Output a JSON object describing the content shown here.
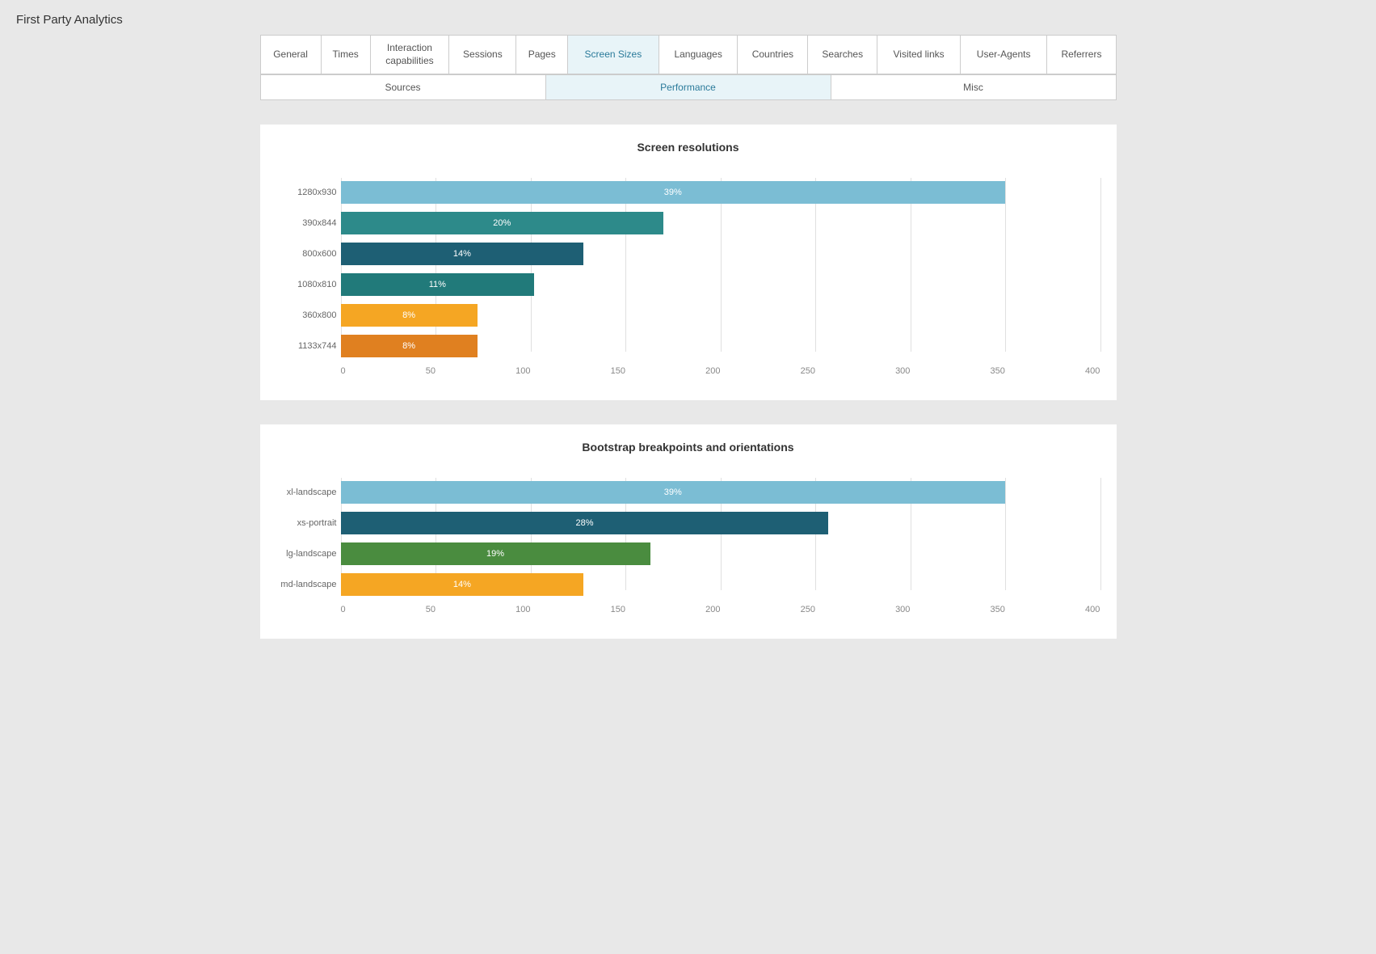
{
  "app": {
    "title": "First Party Analytics"
  },
  "nav": {
    "tabs": [
      {
        "id": "general",
        "label": "General",
        "active": false
      },
      {
        "id": "times",
        "label": "Times",
        "active": false
      },
      {
        "id": "interaction",
        "label": "Interaction\ncapabilities",
        "active": false
      },
      {
        "id": "sessions",
        "label": "Sessions",
        "active": false
      },
      {
        "id": "pages",
        "label": "Pages",
        "active": false
      },
      {
        "id": "screen-sizes",
        "label": "Screen Sizes",
        "active": true
      },
      {
        "id": "languages",
        "label": "Languages",
        "active": false
      },
      {
        "id": "countries",
        "label": "Countries",
        "active": false
      },
      {
        "id": "searches",
        "label": "Searches",
        "active": false
      },
      {
        "id": "visited-links",
        "label": "Visited links",
        "active": false
      },
      {
        "id": "user-agents",
        "label": "User-Agents",
        "active": false
      },
      {
        "id": "referrers",
        "label": "Referrers",
        "active": false
      }
    ],
    "subtabs": [
      {
        "id": "sources",
        "label": "Sources",
        "active": false
      },
      {
        "id": "performance",
        "label": "Performance",
        "active": true
      },
      {
        "id": "misc",
        "label": "Misc",
        "active": false
      }
    ]
  },
  "charts": {
    "screen_resolutions": {
      "title": "Screen resolutions",
      "x_axis": [
        0,
        50,
        100,
        150,
        200,
        250,
        300,
        350,
        400
      ],
      "max_value": 400,
      "bars": [
        {
          "label": "1280x930",
          "value": 39,
          "absolute": 350,
          "color": "lightblue"
        },
        {
          "label": "390x844",
          "value": 20,
          "absolute": 170,
          "color": "teal"
        },
        {
          "label": "800x600",
          "value": 14,
          "absolute": 128,
          "color": "darkblue"
        },
        {
          "label": "1080x810",
          "value": 11,
          "absolute": 102,
          "color": "midteal"
        },
        {
          "label": "360x800",
          "value": 8,
          "absolute": 72,
          "color": "orange"
        },
        {
          "label": "1133x744",
          "value": 8,
          "absolute": 72,
          "color": "darkorange"
        }
      ]
    },
    "bootstrap": {
      "title": "Bootstrap breakpoints and orientations",
      "x_axis": [
        0,
        50,
        100,
        150,
        200,
        250,
        300,
        350,
        400
      ],
      "max_value": 400,
      "bars": [
        {
          "label": "xl-landscape",
          "value": 39,
          "absolute": 350,
          "color": "lightblue"
        },
        {
          "label": "xs-portrait",
          "value": 28,
          "absolute": 257,
          "color": "darkblue"
        },
        {
          "label": "lg-landscape",
          "value": 19,
          "absolute": 163,
          "color": "green"
        },
        {
          "label": "md-landscape",
          "value": 14,
          "absolute": 128,
          "color": "orange"
        }
      ]
    }
  }
}
